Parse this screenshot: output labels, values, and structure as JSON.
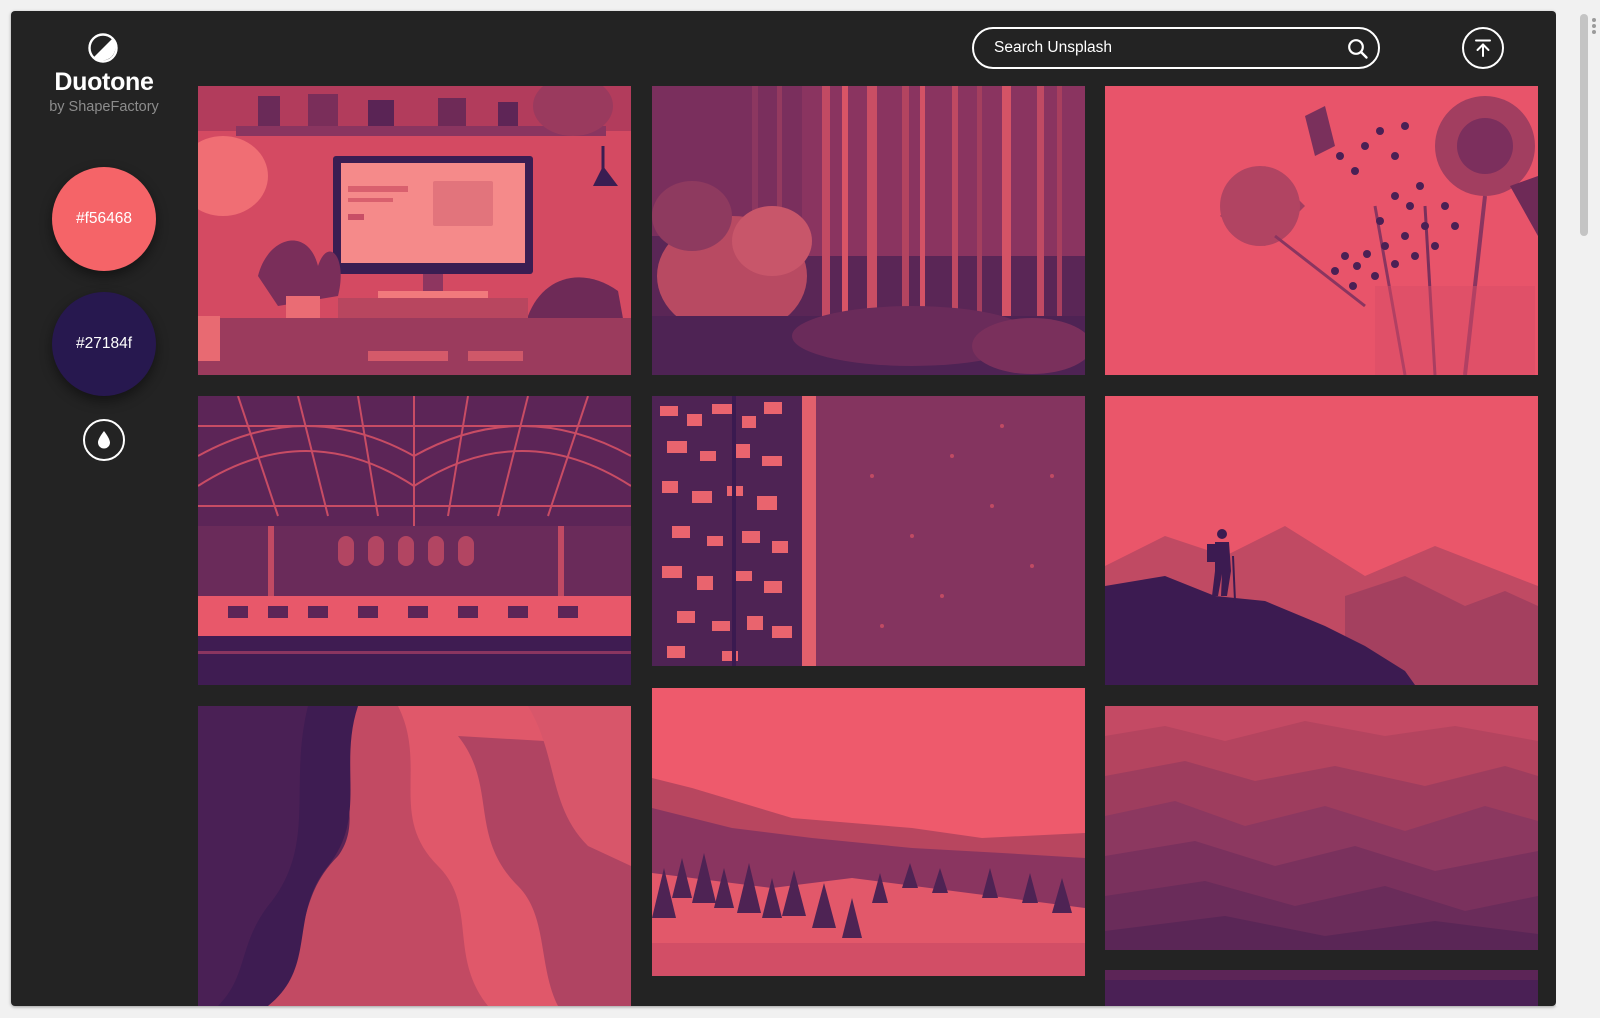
{
  "app": {
    "name": "Duotone",
    "byline": "by ShapeFactory",
    "logo_icon": "half-circle-icon"
  },
  "palette": {
    "highlight": {
      "label": "#f56468",
      "color": "#f56468"
    },
    "shadow": {
      "label": "#27184f",
      "color": "#27184f"
    },
    "toggle_icon": "drop-icon"
  },
  "search": {
    "placeholder": "Search Unsplash",
    "value": "",
    "icon": "search-icon"
  },
  "toolbar": {
    "scroll_top_icon": "arrow-up-to-top-icon"
  },
  "gallery": {
    "photos": [
      {
        "subject": "desk-with-monitor"
      },
      {
        "subject": "birch-forest"
      },
      {
        "subject": "flower-bouquet"
      },
      {
        "subject": "train-station-hall"
      },
      {
        "subject": "aerial-beach-town"
      },
      {
        "subject": "hiker-on-ridge"
      },
      {
        "subject": "sandstone-canyon"
      },
      {
        "subject": "snowy-pine-valley"
      },
      {
        "subject": "layered-mountains"
      },
      {
        "subject": "partial-photo"
      }
    ]
  }
}
